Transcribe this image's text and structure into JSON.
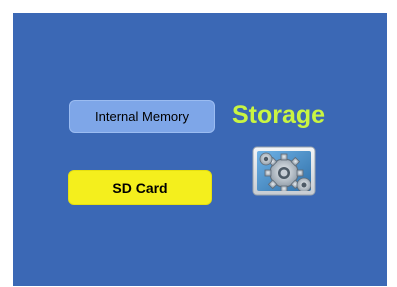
{
  "screen": {
    "background_color": "#3b68b5"
  },
  "buttons": {
    "internal_memory": {
      "label": "Internal Memory",
      "color": "#7ea6e8"
    },
    "sd_card": {
      "label": "SD Card",
      "color": "#f4ef1d"
    }
  },
  "title": {
    "text": "Storage",
    "color": "#c9f542"
  },
  "icon": {
    "name": "settings-gear-icon"
  }
}
